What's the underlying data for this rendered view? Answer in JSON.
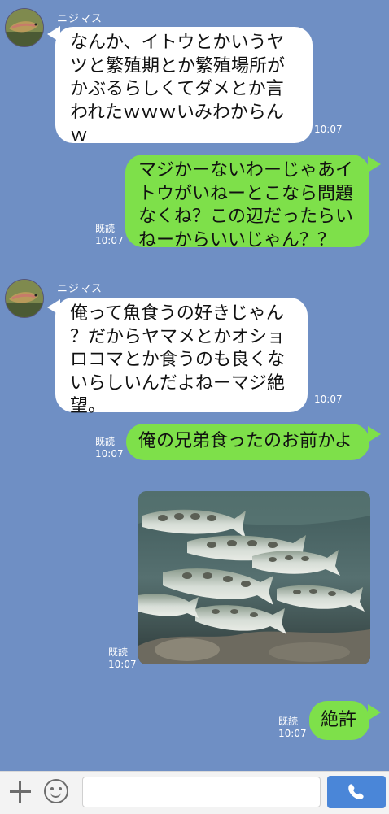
{
  "colors": {
    "background": "#6f8fc4",
    "incoming_bubble": "#ffffff",
    "outgoing_bubble": "#7ee04a",
    "send_button": "#4a86d8"
  },
  "messages": [
    {
      "direction": "incoming",
      "sender": "ニジマス",
      "lines": [
        "なんか、イトウとかいうヤ",
        "ツと繁殖期とか繁殖場所が",
        "かぶるらしくてダメとか言",
        "われたｗｗｗいみわからん",
        "ｗ"
      ],
      "time": "10:07"
    },
    {
      "direction": "outgoing",
      "lines": [
        "マジかーないわーじゃあイ",
        "トウがいねーとこなら問題",
        "なくね？この辺だったらい",
        "ねーからいいじゃん？？"
      ],
      "read": "既読",
      "time": "10:07"
    },
    {
      "direction": "incoming",
      "sender": "ニジマス",
      "lines": [
        "俺って魚食うの好きじゃん",
        "？だからヤマメとかオショ",
        "ロコマとか食うのも良くな",
        "いらしいんだよねーマジ絶",
        "望。"
      ],
      "time": "10:07"
    },
    {
      "direction": "outgoing",
      "lines": [
        "俺の兄弟食ったのお前かよ"
      ],
      "read": "既読",
      "time": "10:07"
    },
    {
      "direction": "outgoing",
      "type": "image",
      "image_icon": "trout-school-photo",
      "read": "既読",
      "time": "10:07"
    },
    {
      "direction": "outgoing",
      "lines": [
        "絶許"
      ],
      "read": "既読",
      "time": "10:07"
    }
  ],
  "input_bar": {
    "icons": [
      "plus-icon",
      "smiley-icon",
      "phone-icon"
    ],
    "placeholder": ""
  }
}
